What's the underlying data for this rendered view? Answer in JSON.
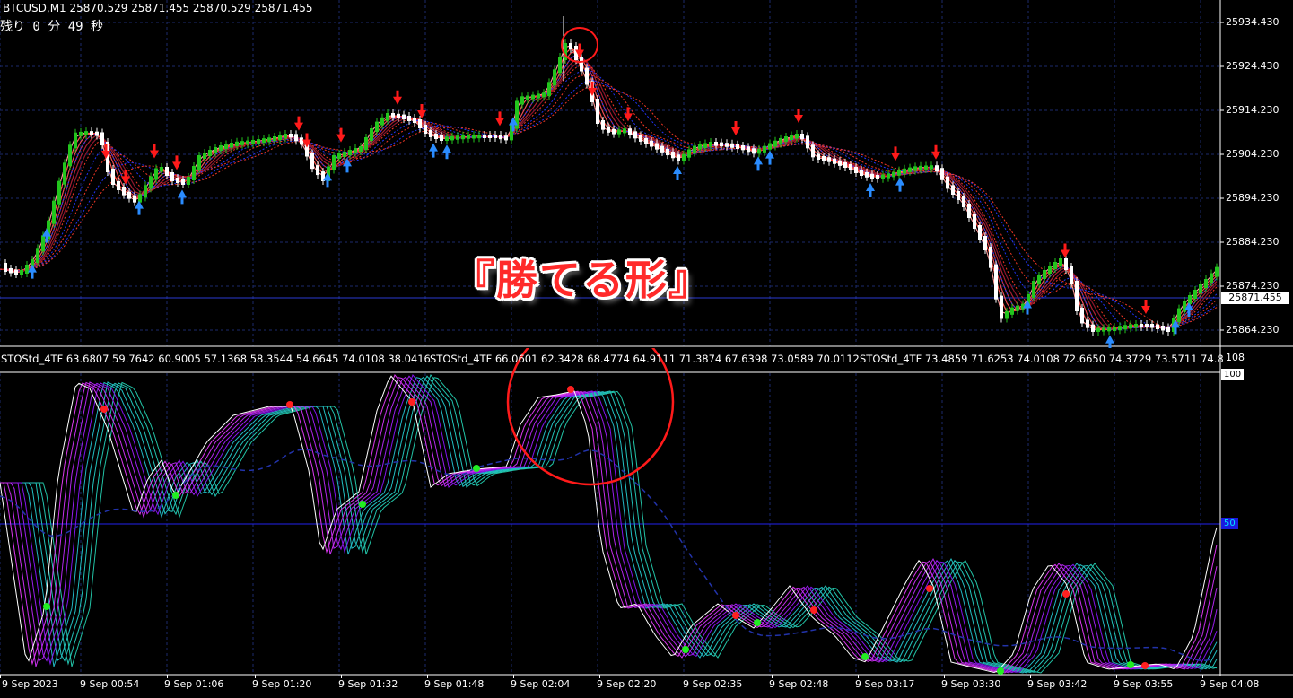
{
  "header": {
    "symbol_line": "BTCUSD,M1  25870.529 25871.455 25870.529 25871.455",
    "countdown": "残り 0 分 49 秒"
  },
  "price_axis": {
    "labels": [
      "25934.430",
      "25924.430",
      "25914.230",
      "25904.230",
      "25894.230",
      "25884.230",
      "25874.230",
      "25864.230"
    ],
    "current_price": "25871.455"
  },
  "indicator": {
    "caption_1": "STOStd_4TF 63.6807 59.7642 60.9005 57.1368 58.3544 54.6645 74.0108 38.0416",
    "caption_2": "STOStd_4TF 66.0601 62.3428 68.4774 64.9111 71.3874 67.6398 73.0589 70.0112",
    "caption_3": "STOStd_4TF 73.4859 71.6253 74.0108 72.6650 74.3729 73.5711 74.8",
    "axis_max": "108",
    "level_100": "100",
    "level_mid": "50"
  },
  "time_axis": [
    "9 Sep 2023",
    "9 Sep 00:54",
    "9 Sep 01:06",
    "9 Sep 01:20",
    "9 Sep 01:32",
    "9 Sep 01:48",
    "9 Sep 02:04",
    "9 Sep 02:20",
    "9 Sep 02:35",
    "9 Sep 02:48",
    "9 Sep 03:17",
    "9 Sep 03:30",
    "9 Sep 03:42",
    "9 Sep 03:55",
    "9 Sep 04:08"
  ],
  "annotation": {
    "text": "『勝てる形』"
  },
  "colors": {
    "background": "#000000",
    "bull_candle": "#22c51d",
    "bear_candle": "#ffffff",
    "down_arrow": "#ff1a1a",
    "up_arrow": "#2a8cff",
    "grid": "#1b2a6b",
    "annotation_red": "#ff2a2a"
  }
}
